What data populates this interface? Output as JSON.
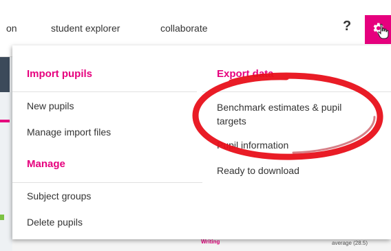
{
  "nav": {
    "partial_item": "on",
    "student_explorer": "student explorer",
    "collaborate": "collaborate",
    "help": "?",
    "settings_icon": "gear-icon"
  },
  "background": {
    "writing_label": "Writing",
    "average_label": "average (28.5)"
  },
  "menu": {
    "import": {
      "title": "Import pupils",
      "items": [
        "New pupils",
        "Manage import files"
      ]
    },
    "manage": {
      "title": "Manage",
      "items": [
        "Subject groups",
        "Delete pupils"
      ]
    },
    "export": {
      "title": "Export data",
      "items": [
        "Benchmark estimates & pupil targets",
        "Pupil information",
        "Ready to download"
      ]
    }
  },
  "colors": {
    "accent": "#e6007e",
    "annotation": "#e8101a"
  }
}
